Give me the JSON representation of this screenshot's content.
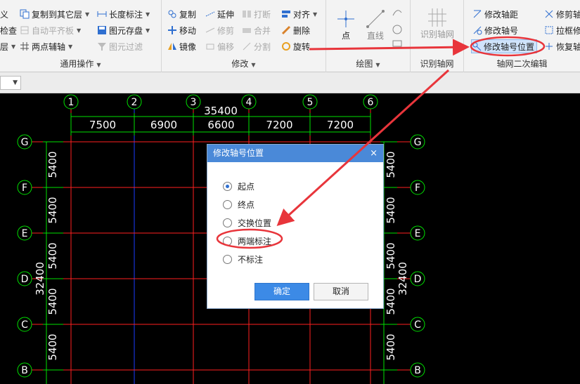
{
  "ribbon": {
    "group_common": {
      "label": "通用操作",
      "items": [
        {
          "label": "复制到其它层",
          "enabled": true,
          "dropdown": true
        },
        {
          "label": "自动平齐板",
          "enabled": false,
          "dropdown": true
        },
        {
          "label": "两点辅轴",
          "enabled": true,
          "dropdown": true
        },
        {
          "label": "长度标注",
          "enabled": true,
          "dropdown": true
        },
        {
          "label": "图元存盘",
          "enabled": true,
          "dropdown": true
        },
        {
          "label": "图元过滤",
          "enabled": false,
          "dropdown": false
        }
      ],
      "partial_items": [
        "义",
        "检查",
        "层"
      ]
    },
    "group_modify": {
      "label": "修改",
      "items": [
        {
          "label": "复制",
          "enabled": true
        },
        {
          "label": "延伸",
          "enabled": true
        },
        {
          "label": "打断",
          "enabled": false
        },
        {
          "label": "对齐",
          "enabled": true,
          "dropdown": true
        },
        {
          "label": "移动",
          "enabled": true
        },
        {
          "label": "修剪",
          "enabled": false
        },
        {
          "label": "合并",
          "enabled": false
        },
        {
          "label": "删除",
          "enabled": true
        },
        {
          "label": "镜像",
          "enabled": true
        },
        {
          "label": "偏移",
          "enabled": false
        },
        {
          "label": "分割",
          "enabled": false
        },
        {
          "label": "旋转",
          "enabled": true
        }
      ]
    },
    "group_draw": {
      "label": "绘图",
      "items": [
        {
          "label": "点"
        },
        {
          "label": "直线"
        }
      ]
    },
    "group_identify": {
      "label": "识别轴网",
      "button": "识别轴网"
    },
    "group_secondary": {
      "label": "轴网二次编辑",
      "items": [
        {
          "label": "修改轴距"
        },
        {
          "label": "修改轴号"
        },
        {
          "label": "修改轴号位置"
        },
        {
          "label": "修剪轴"
        },
        {
          "label": "拉框修"
        },
        {
          "label": "恢复轴"
        }
      ]
    }
  },
  "drawing": {
    "top_total": "35400",
    "column_axes": [
      "1",
      "2",
      "3",
      "4",
      "5",
      "6"
    ],
    "column_spacings": [
      "7500",
      "6900",
      "6600",
      "7200",
      "7200"
    ],
    "row_axes": [
      "G",
      "F",
      "E",
      "D",
      "C",
      "B"
    ],
    "row_spacings": [
      "5400",
      "5400",
      "5400",
      "5400",
      "5400"
    ],
    "side_total": "32400"
  },
  "dialog": {
    "title": "修改轴号位置",
    "close": "×",
    "options": [
      "起点",
      "终点",
      "交换位置",
      "两端标注",
      "不标注"
    ],
    "selected_index": 0,
    "ok": "确定",
    "cancel": "取消"
  },
  "colors": {
    "ribbon_bg": "#f3f3f3",
    "title_bar": "#4a89d8",
    "primary_button": "#3c8ae6",
    "annotation_red": "#e8353b",
    "grid_red": "#ff0000",
    "grid_green": "#00ff00",
    "canvas": "#000000"
  }
}
